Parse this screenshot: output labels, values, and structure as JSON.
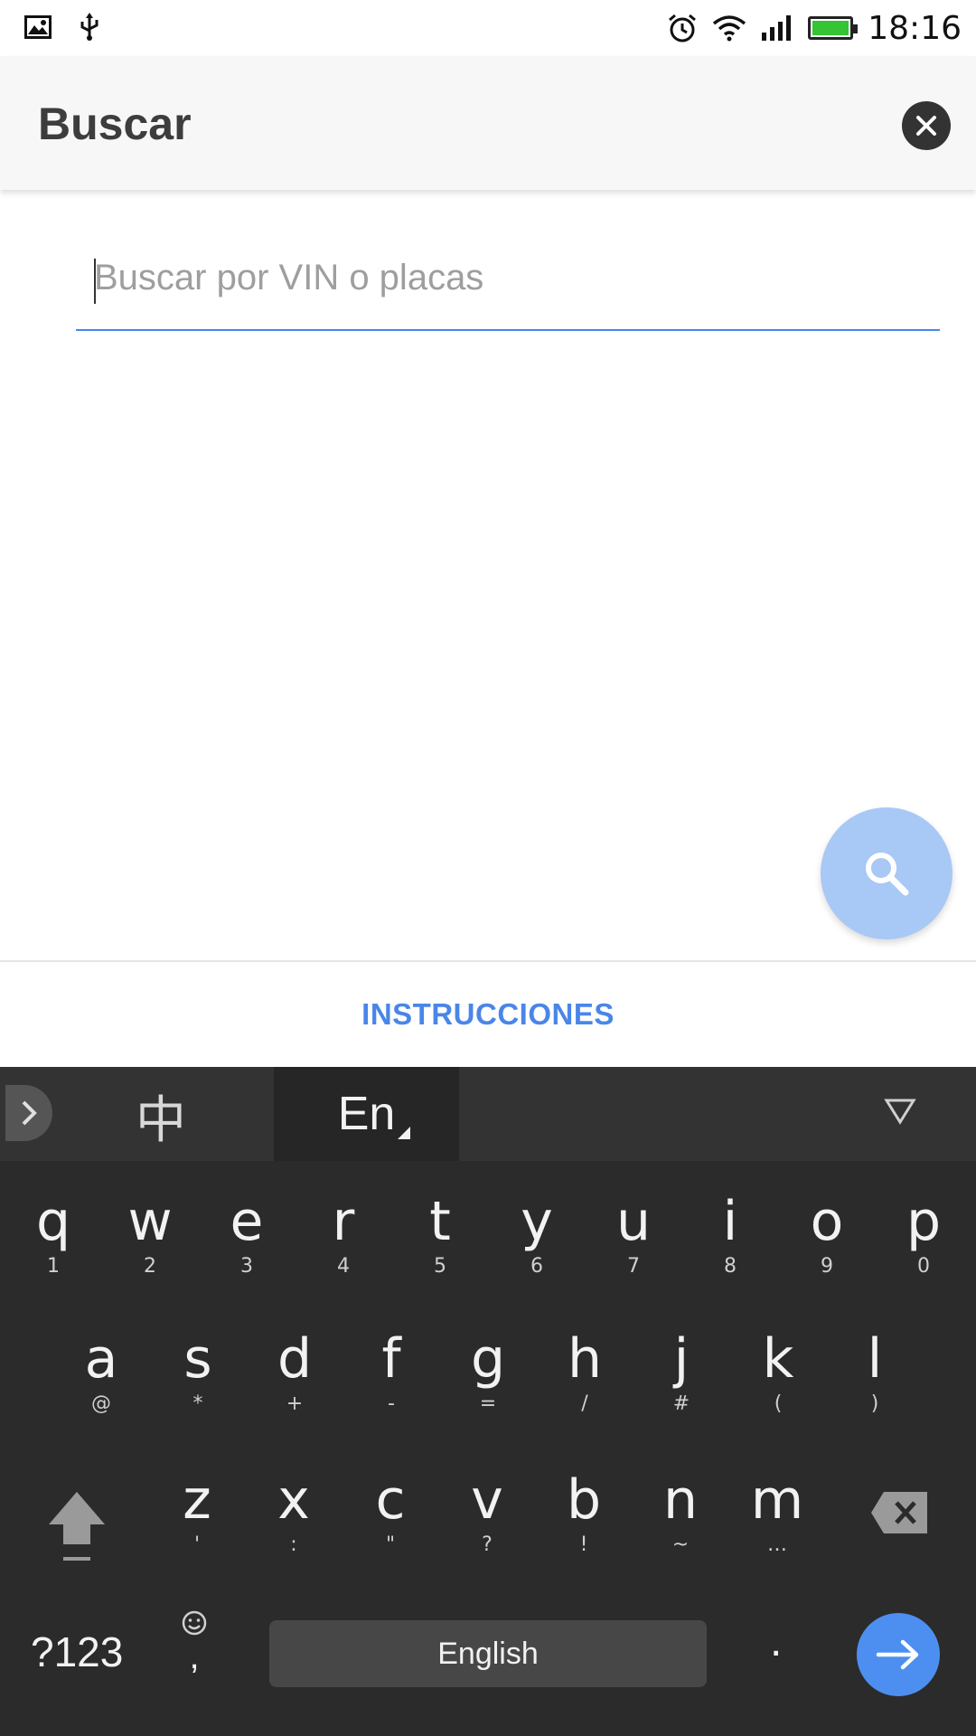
{
  "status_bar": {
    "time": "18:16",
    "icons": [
      "image-icon",
      "usb-icon",
      "alarm-icon",
      "wifi-icon",
      "signal-icon",
      "battery-icon"
    ],
    "battery_color": "#35c433"
  },
  "app_bar": {
    "title": "Buscar",
    "close_icon": "close-icon"
  },
  "search": {
    "placeholder": "Buscar por VIN o placas",
    "value": "",
    "accent_color": "#4a86e8"
  },
  "fab": {
    "icon": "search-icon",
    "color": "#a8c8f5"
  },
  "footer": {
    "instructions_label": "INSTRUCCIONES",
    "color": "#4a86e8"
  },
  "keyboard": {
    "lang_zh": "中",
    "lang_en": "En",
    "row1": [
      {
        "k": "q",
        "s": "1"
      },
      {
        "k": "w",
        "s": "2"
      },
      {
        "k": "e",
        "s": "3"
      },
      {
        "k": "r",
        "s": "4"
      },
      {
        "k": "t",
        "s": "5"
      },
      {
        "k": "y",
        "s": "6"
      },
      {
        "k": "u",
        "s": "7"
      },
      {
        "k": "i",
        "s": "8"
      },
      {
        "k": "o",
        "s": "9"
      },
      {
        "k": "p",
        "s": "0"
      }
    ],
    "row2": [
      {
        "k": "a",
        "s": "@"
      },
      {
        "k": "s",
        "s": "*"
      },
      {
        "k": "d",
        "s": "+"
      },
      {
        "k": "f",
        "s": "-"
      },
      {
        "k": "g",
        "s": "="
      },
      {
        "k": "h",
        "s": "/"
      },
      {
        "k": "j",
        "s": "#"
      },
      {
        "k": "k",
        "s": "("
      },
      {
        "k": "l",
        "s": ")"
      }
    ],
    "row3": [
      {
        "k": "z",
        "s": "'"
      },
      {
        "k": "x",
        "s": ":"
      },
      {
        "k": "c",
        "s": "\""
      },
      {
        "k": "v",
        "s": "?"
      },
      {
        "k": "b",
        "s": "!"
      },
      {
        "k": "n",
        "s": "~"
      },
      {
        "k": "m",
        "s": "…"
      }
    ],
    "symbols_label": "?123",
    "comma_label": ",",
    "space_label": "English",
    "period_label": ".",
    "enter_color": "#4d8ff0"
  }
}
